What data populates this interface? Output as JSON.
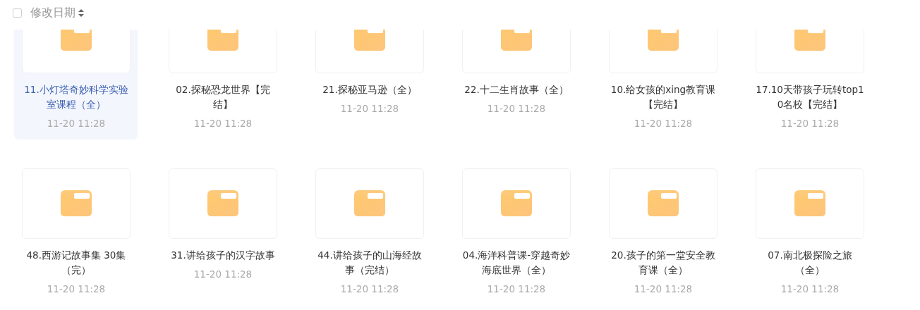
{
  "header": {
    "select_all_checked": false,
    "sort_label": "修改日期"
  },
  "items": [
    {
      "name": "11.小灯塔奇妙科学实验室课程（全）",
      "date": "11-20 11:28",
      "selected": true
    },
    {
      "name": "02.探秘恐龙世界【完结】",
      "date": "11-20 11:28",
      "selected": false
    },
    {
      "name": "21.探秘亚马逊（全）",
      "date": "11-20 11:28",
      "selected": false
    },
    {
      "name": "22.十二生肖故事（全）",
      "date": "11-20 11:28",
      "selected": false
    },
    {
      "name": "10.给女孩的xing教育课【完结】",
      "date": "11-20 11:28",
      "selected": false
    },
    {
      "name": "17.10天带孩子玩转top10名校【完结】",
      "date": "11-20 11:28",
      "selected": false
    },
    {
      "name": "48.西游记故事集 30集（完）",
      "date": "11-20 11:28",
      "selected": false
    },
    {
      "name": "31.讲给孩子的汉字故事",
      "date": "11-20 11:28",
      "selected": false
    },
    {
      "name": "44.讲给孩子的山海经故事（完结）",
      "date": "11-20 11:28",
      "selected": false
    },
    {
      "name": "04.海洋科普课-穿越奇妙海底世界（全）",
      "date": "11-20 11:28",
      "selected": false
    },
    {
      "name": "20.孩子的第一堂安全教育课（全）",
      "date": "11-20 11:28",
      "selected": false
    },
    {
      "name": "07.南北极探险之旅（全）",
      "date": "11-20 11:28",
      "selected": false
    }
  ]
}
